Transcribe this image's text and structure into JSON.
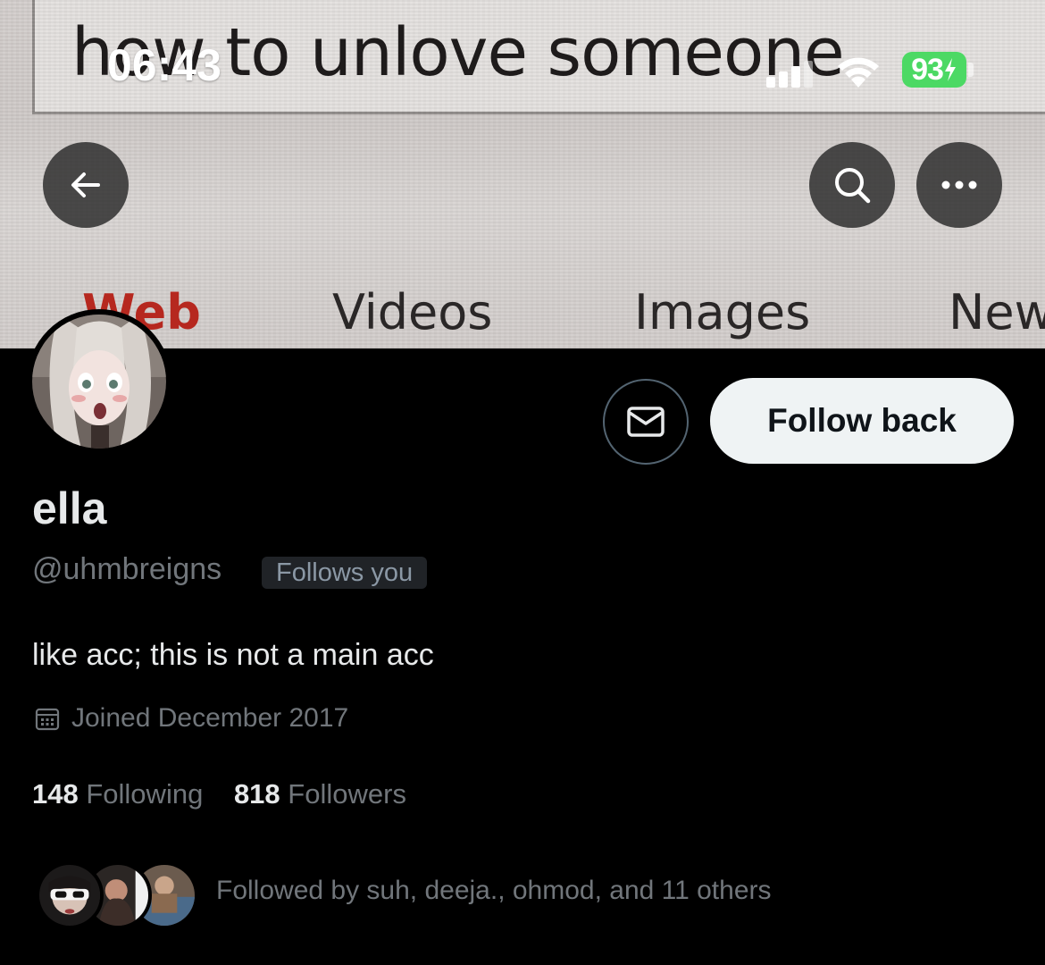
{
  "status_bar": {
    "time": "06:43",
    "battery": "93"
  },
  "banner": {
    "search_text": "how to unlove someone",
    "tabs": [
      "Web",
      "Videos",
      "Images",
      "New"
    ]
  },
  "nav": {
    "back_icon": "arrow-left-icon",
    "search_icon": "search-icon",
    "more_icon": "more-horizontal-icon"
  },
  "actions": {
    "message_icon": "envelope-icon",
    "follow_label": "Follow back"
  },
  "profile": {
    "name": "ella",
    "handle": "@uhmbreigns",
    "follows_you": "Follows you",
    "bio": "like acc; this is not a main acc",
    "joined": "Joined December 2017",
    "following_count": "148",
    "following_label": "Following",
    "followers_count": "818",
    "followers_label": "Followers",
    "followed_by": "Followed by suh, deeja., ohmod, and 11 others"
  },
  "colors": {
    "background": "#000000",
    "primary_text": "#e7e9ea",
    "secondary_text": "#71767b",
    "follow_button_bg": "#eff3f4",
    "battery_green": "#4cd964"
  }
}
